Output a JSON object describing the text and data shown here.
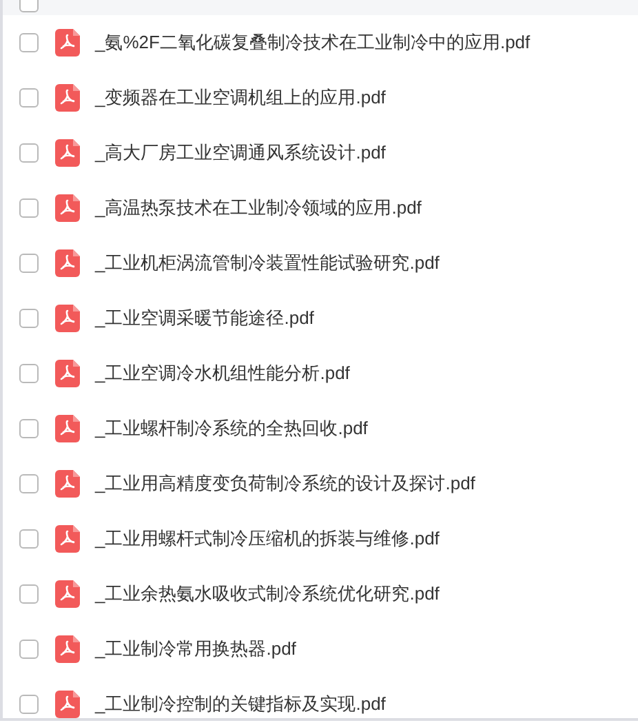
{
  "header": {
    "checked": false
  },
  "files": [
    {
      "name": "_氨%2F二氧化碳复叠制冷技术在工业制冷中的应用.pdf",
      "checked": false
    },
    {
      "name": "_变频器在工业空调机组上的应用.pdf",
      "checked": false
    },
    {
      "name": "_高大厂房工业空调通风系统设计.pdf",
      "checked": false
    },
    {
      "name": "_高温热泵技术在工业制冷领域的应用.pdf",
      "checked": false
    },
    {
      "name": "_工业机柜涡流管制冷装置性能试验研究.pdf",
      "checked": false
    },
    {
      "name": "_工业空调采暖节能途径.pdf",
      "checked": false
    },
    {
      "name": "_工业空调冷水机组性能分析.pdf",
      "checked": false
    },
    {
      "name": "_工业螺杆制冷系统的全热回收.pdf",
      "checked": false
    },
    {
      "name": "_工业用高精度变负荷制冷系统的设计及探讨.pdf",
      "checked": false
    },
    {
      "name": "_工业用螺杆式制冷压缩机的拆装与维修.pdf",
      "checked": false
    },
    {
      "name": "_工业余热氨水吸收式制冷系统优化研究.pdf",
      "checked": false
    },
    {
      "name": "_工业制冷常用换热器.pdf",
      "checked": false
    },
    {
      "name": "_工业制冷控制的关键指标及实现.pdf",
      "checked": false
    }
  ]
}
